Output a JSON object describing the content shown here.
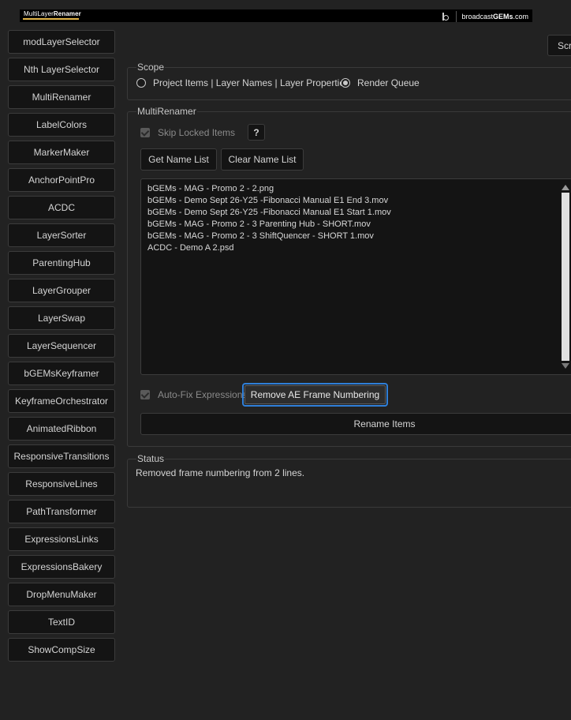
{
  "banner": {
    "logo_prefix": "MultiLayer",
    "logo_bold": "Renamer",
    "brand_prefix": "broadcast",
    "brand_bold": "GEMs",
    "brand_suffix": ".com"
  },
  "tools": [
    "modLayerSelector",
    "Nth LayerSelector",
    "MultiRenamer",
    "LabelColors",
    "MarkerMaker",
    "AnchorPointPro",
    "ACDC",
    "LayerSorter",
    "ParentingHub",
    "LayerGrouper",
    "LayerSwap",
    "LayerSequencer",
    "bGEMsKeyframer",
    "KeyframeOrchestrator",
    "AnimatedRibbon",
    "ResponsiveTransitions",
    "ResponsiveLines",
    "PathTransformer",
    "ExpressionsLinks",
    "ExpressionsBakery",
    "DropMenuMaker",
    "TextID",
    "ShowCompSize"
  ],
  "top_right_button": "Scr",
  "scope": {
    "title": "Scope",
    "option_project": "Project Items | Layer Names | Layer Properties",
    "option_render": "Render Queue",
    "selected": "Render Queue"
  },
  "multirenamer": {
    "title": "MultiRenamer",
    "skip_locked_label": "Skip Locked Items",
    "skip_locked_checked": true,
    "help_label": "?",
    "get_list_label": "Get Name List",
    "clear_list_label": "Clear Name List",
    "name_lines": [
      "bGEMs - MAG - Promo 2 - 2.png",
      "bGEMs - Demo Sept 26-Y25 -Fibonacci Manual E1 End 3.mov",
      "bGEMs - Demo Sept 26-Y25 -Fibonacci Manual E1 Start 1.mov",
      "bGEMs - MAG - Promo 2 - 3 Parenting Hub - SHORT.mov",
      "bGEMs - MAG - Promo 2 - 3 ShiftQuencer - SHORT 1.mov",
      "ACDC - Demo A 2.psd"
    ],
    "auto_fix_label": "Auto-Fix Expressions",
    "auto_fix_checked": true,
    "remove_frame_label": "Remove AE Frame Numbering",
    "rename_label": "Rename Items"
  },
  "status": {
    "title": "Status",
    "message": "Removed frame numbering from 2 lines."
  },
  "colors": {
    "background": "#222222",
    "button_bg": "#141414",
    "focus_ring": "#2f7fd8",
    "logo_underline": "#e0b44a"
  }
}
